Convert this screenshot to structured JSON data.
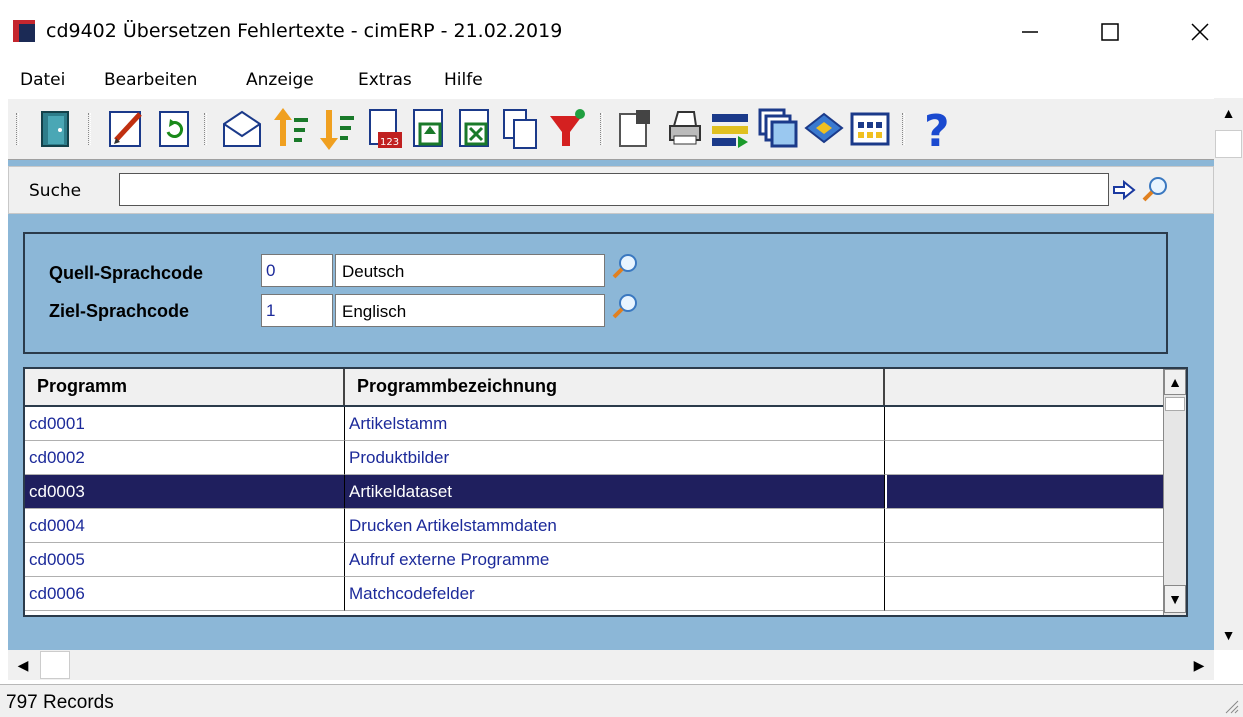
{
  "window": {
    "title": "cd9402 Übersetzen Fehlertexte - cimERP - 21.02.2019"
  },
  "menu": {
    "items": [
      "Datei",
      "Bearbeiten",
      "Anzeige",
      "Extras",
      "Hilfe"
    ]
  },
  "toolbar": {
    "icons": [
      "door-exit-icon",
      "edit-icon",
      "refresh-icon",
      "envelope-icon",
      "sort-ascending-icon",
      "sort-descending-icon",
      "calculator-icon",
      "export-icon",
      "excel-icon",
      "copy-icon",
      "filter-icon",
      "properties-icon",
      "print-icon",
      "list-transfer-icon",
      "windows-icon",
      "book-icon",
      "table-icon",
      "help-icon"
    ]
  },
  "search": {
    "label": "Suche",
    "value": ""
  },
  "params": {
    "source_label": "Quell-Sprachcode",
    "source_code": "0",
    "source_name": "Deutsch",
    "target_label": "Ziel-Sprachcode",
    "target_code": "1",
    "target_name": "Englisch"
  },
  "grid": {
    "columns": [
      "Programm",
      "Programmbezeichnung",
      ""
    ],
    "rows": [
      {
        "program": "cd0001",
        "name": "Artikelstamm",
        "extra": "",
        "selected": false
      },
      {
        "program": "cd0002",
        "name": "Produktbilder",
        "extra": "",
        "selected": false
      },
      {
        "program": "cd0003",
        "name": "Artikeldataset",
        "extra": "",
        "selected": true
      },
      {
        "program": "cd0004",
        "name": "Drucken Artikelstammdaten",
        "extra": "",
        "selected": false
      },
      {
        "program": "cd0005",
        "name": "Aufruf externe Programme",
        "extra": "",
        "selected": false
      },
      {
        "program": "cd0006",
        "name": "Matchcodefelder",
        "extra": "",
        "selected": false
      }
    ]
  },
  "status": {
    "text": "797 Records"
  },
  "colors": {
    "client_bg": "#8cb7d7",
    "selected_row": "#1f1f5e",
    "data_text": "#1c2a9a"
  }
}
